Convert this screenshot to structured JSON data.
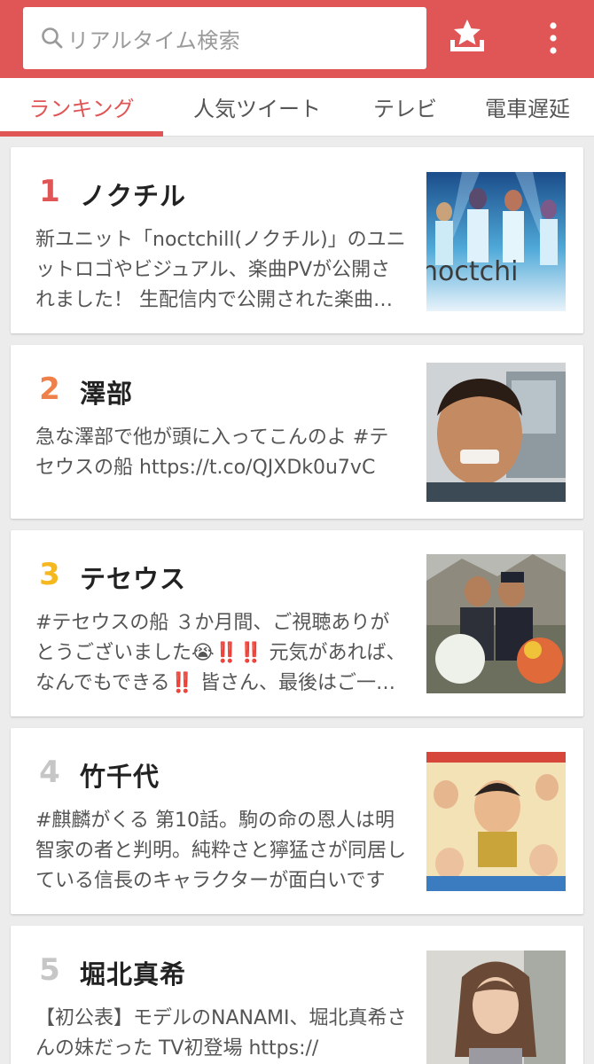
{
  "search": {
    "placeholder": "リアルタイム検索"
  },
  "header": {
    "favorite_icon": "star-tray-icon",
    "menu_icon": "more-vertical-icon"
  },
  "colors": {
    "accent": "#e05556",
    "rank1": "#e05556",
    "rank2": "#f0804a",
    "rank3": "#f5b81e",
    "rank_other": "#c6c6c6"
  },
  "tabs": [
    {
      "label": "ランキング",
      "active": true
    },
    {
      "label": "人気ツイート",
      "active": false
    },
    {
      "label": "テレビ",
      "active": false
    },
    {
      "label": "電車遅延",
      "active": false
    }
  ],
  "items": [
    {
      "rank": "1",
      "keyword": "ノクチル",
      "description": "新ユニット「noctchill(ノクチル)」のユニットロゴやビジュアル、楽曲PVが公開されました！ 生配信内で公開された楽曲やイベント"
    },
    {
      "rank": "2",
      "keyword": "澤部",
      "description": "急な澤部で他が頭に入ってこんのよ #テセウスの船 https://t.co/QJXDk0u7vC"
    },
    {
      "rank": "3",
      "keyword": "テセウス",
      "description": "#テセウスの船 ３か月間、ご視聴ありがとうございました😭‼️‼️ 元気があれば、なんでもできる‼️ 皆さん、最後はご一緒に"
    },
    {
      "rank": "4",
      "keyword": "竹千代",
      "description": "#麒麟がくる 第10話。駒の命の恩人は明智家の者と判明。純粋さと獰猛さが同居している信長のキャラクターが面白いです"
    },
    {
      "rank": "5",
      "keyword": "堀北真希",
      "description": "【初公表】モデルのNANAMI、堀北真希さんの妹だった TV初登場 https://"
    }
  ]
}
